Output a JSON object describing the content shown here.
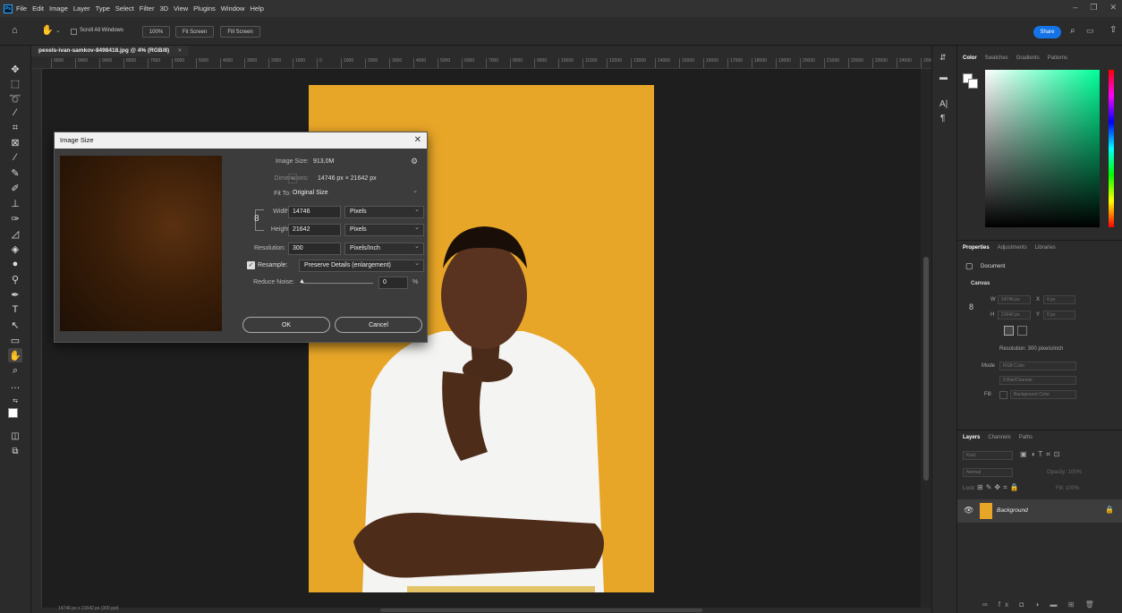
{
  "menu": {
    "items": [
      "File",
      "Edit",
      "Image",
      "Layer",
      "Type",
      "Select",
      "Filter",
      "3D",
      "View",
      "Plugins",
      "Window",
      "Help"
    ]
  },
  "options": {
    "scroll_all_windows": "Scroll All Windows",
    "zoom_100": "100%",
    "fit_screen": "Fit Screen",
    "fill_screen": "Fill Screen",
    "share": "Share"
  },
  "document": {
    "tab_title": "pexels-ivan-samkov-8498418.jpg @ 4% (RGB/8)",
    "status": "14746 px x 21642 px (300 ppi)"
  },
  "ruler": {
    "h_ticks": [
      "9000",
      "9000",
      "9000",
      "8000",
      "7000",
      "6000",
      "5000",
      "4000",
      "3000",
      "2000",
      "1000",
      "0",
      "1000",
      "2000",
      "3000",
      "4000",
      "5000",
      "6000",
      "7000",
      "8000",
      "9000",
      "10000",
      "11000",
      "12000",
      "13000",
      "14000",
      "15000",
      "16000",
      "17000",
      "18000",
      "19000",
      "20000",
      "21000",
      "22000",
      "23000",
      "24000",
      "25000"
    ]
  },
  "dialog": {
    "title": "Image Size",
    "image_size_label": "Image Size:",
    "image_size_value": "913,0M",
    "dimensions_label": "Dimensions:",
    "dimensions_value": "14746 px  ×  21642 px",
    "fit_to_label": "Fit To:",
    "fit_to_value": "Original Size",
    "width_label": "Width:",
    "width_value": "14746",
    "width_unit": "Pixels",
    "height_label": "Height:",
    "height_value": "21642",
    "height_unit": "Pixels",
    "resolution_label": "Resolution:",
    "resolution_value": "300",
    "resolution_unit": "Pixels/Inch",
    "resample_label": "Resample:",
    "resample_value": "Preserve Details (enlargement)",
    "reduce_noise_label": "Reduce Noise:",
    "reduce_noise_value": "0",
    "reduce_noise_unit": "%",
    "ok": "OK",
    "cancel": "Cancel"
  },
  "color_panel": {
    "tabs": [
      "Color",
      "Swatches",
      "Gradients",
      "Patterns"
    ],
    "hue_color": "#00ff99"
  },
  "properties_panel": {
    "tabs": [
      "Properties",
      "Adjustments",
      "Libraries"
    ],
    "document_label": "Document",
    "canvas_label": "Canvas",
    "w_label": "W",
    "w_value": "14746 px",
    "x_label": "X",
    "x_value": "0 px",
    "h_label": "H",
    "h_value": "21642 px",
    "y_label": "Y",
    "y_value": "0 px",
    "resolution_text": "Resolution: 300 pixels/inch",
    "mode_label": "Mode",
    "mode_value": "RGB Color",
    "bits_value": "8 Bits/Channel",
    "fill_label": "Fill",
    "fill_value": "Background Color"
  },
  "layers_panel": {
    "tabs": [
      "Layers",
      "Channels",
      "Paths"
    ],
    "kind_placeholder": "Kind",
    "blend_mode": "Normal",
    "opacity": "Opacity: 100%",
    "lock_label": "Lock:",
    "fill": "Fill: 100%",
    "layer_name": "Background"
  }
}
